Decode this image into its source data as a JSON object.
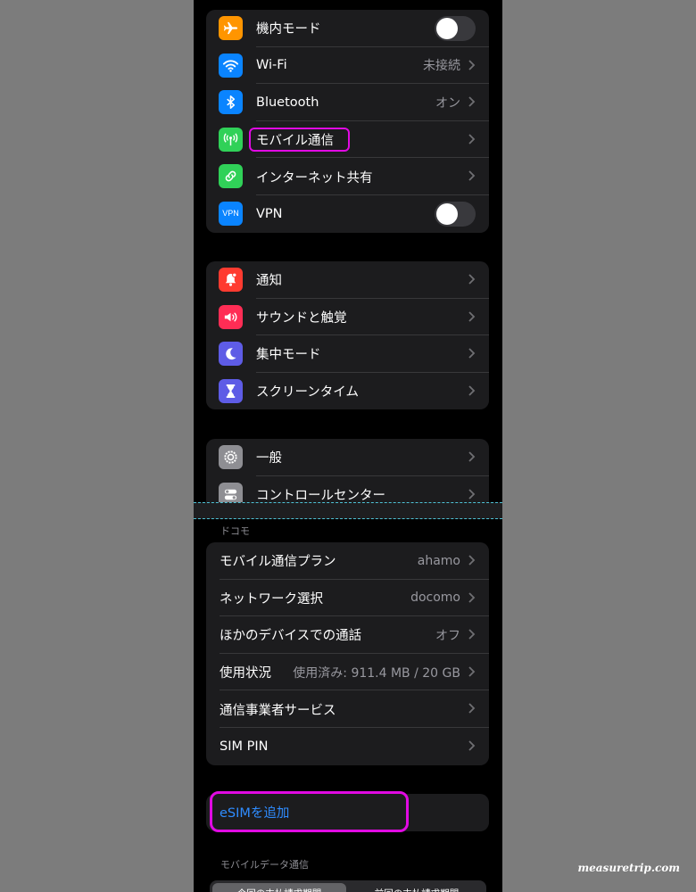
{
  "group1": {
    "rows": [
      {
        "label": "機内モード",
        "icon": "airplane-icon",
        "icon_color": "#ff9500",
        "type": "toggle",
        "on": false
      },
      {
        "label": "Wi-Fi",
        "icon": "wifi-icon",
        "icon_color": "#0a84ff",
        "value": "未接続"
      },
      {
        "label": "Bluetooth",
        "icon": "bluetooth-icon",
        "icon_color": "#0a84ff",
        "value": "オン"
      },
      {
        "label": "モバイル通信",
        "icon": "antenna-icon",
        "icon_color": "#30d158",
        "value": ""
      },
      {
        "label": "インターネット共有",
        "icon": "link-icon",
        "icon_color": "#30d158",
        "value": ""
      },
      {
        "label": "VPN",
        "icon": "vpn-icon",
        "icon_color": "#0a84ff",
        "icon_text": "VPN",
        "type": "toggle",
        "on": false
      }
    ]
  },
  "group2": {
    "rows": [
      {
        "label": "通知",
        "icon": "bell-icon",
        "icon_color": "#ff3b30"
      },
      {
        "label": "サウンドと触覚",
        "icon": "speaker-icon",
        "icon_color": "#ff2d55"
      },
      {
        "label": "集中モード",
        "icon": "moon-icon",
        "icon_color": "#5e5ce6"
      },
      {
        "label": "スクリーンタイム",
        "icon": "hourglass-icon",
        "icon_color": "#5e5ce6"
      }
    ]
  },
  "group3": {
    "rows": [
      {
        "label": "一般",
        "icon": "gear-icon",
        "icon_color": "#8e8e93"
      },
      {
        "label": "コントロールセンター",
        "icon": "switches-icon",
        "icon_color": "#8e8e93"
      }
    ]
  },
  "carrier_header": "ドコモ",
  "group4": {
    "rows": [
      {
        "label": "モバイル通信プラン",
        "value": "ahamo"
      },
      {
        "label": "ネットワーク選択",
        "value": "docomo"
      },
      {
        "label": "ほかのデバイスでの通話",
        "value": "オフ"
      },
      {
        "label": "使用状況",
        "value": "使用済み: 911.4 MB / 20 GB"
      },
      {
        "label": "通信事業者サービス",
        "value": ""
      },
      {
        "label": "SIM PIN",
        "value": ""
      }
    ]
  },
  "esim": {
    "label": "eSIMを追加"
  },
  "mobile_data_header": "モバイルデータ通信",
  "segment": {
    "left": "今回の支払請求期間",
    "right": "前回の支払請求期間"
  },
  "watermark": "measuretrip.com",
  "colors": {
    "highlight": "#e10ae3",
    "accent": "#2f8cff"
  }
}
